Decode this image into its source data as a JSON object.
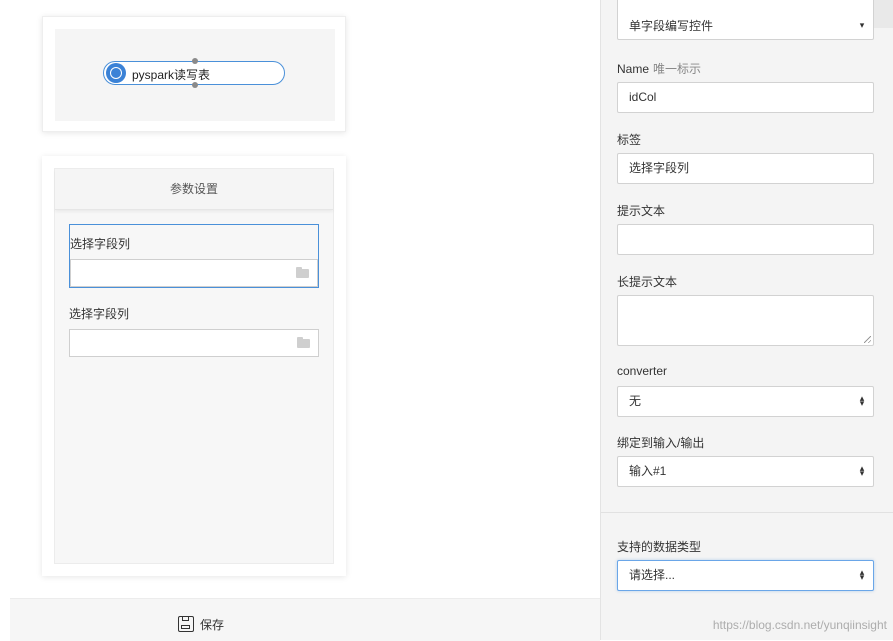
{
  "canvas": {
    "node_label": "pyspark读写表"
  },
  "param_panel": {
    "title": "参数设置",
    "fields": [
      {
        "label": "选择字段列",
        "value": ""
      },
      {
        "label": "选择字段列",
        "value": ""
      }
    ]
  },
  "toolbar": {
    "save_label": "保存"
  },
  "properties": {
    "top_select_value": "单字段编写控件",
    "name_label": "Name",
    "name_sublabel": "唯一标示",
    "name_value": "idCol",
    "tag_label": "标签",
    "tag_value": "选择字段列",
    "hint_label": "提示文本",
    "hint_value": "",
    "long_hint_label": "长提示文本",
    "long_hint_value": "",
    "converter_label": "converter",
    "converter_value": "无",
    "bind_label": "绑定到输入/输出",
    "bind_value": "输入#1",
    "datatype_label": "支持的数据类型",
    "datatype_value": "请选择..."
  },
  "watermark": "https://blog.csdn.net/yunqiinsight",
  "colors": {
    "accent": "#4a90d9",
    "node_circle": "#3b82d6"
  }
}
